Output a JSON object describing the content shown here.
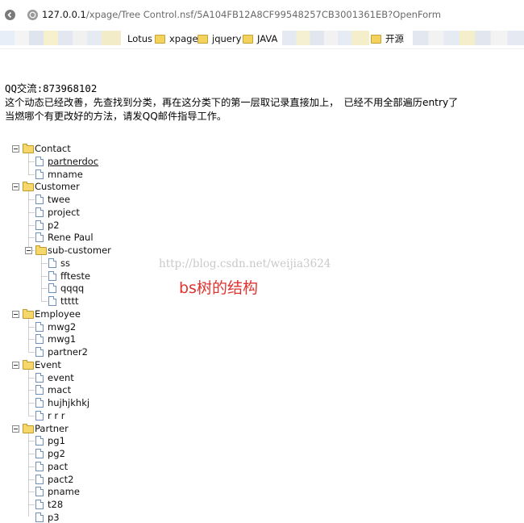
{
  "browser": {
    "url_host": "127.0.0.1",
    "url_path": "/xpage/Tree Control.nsf/5A104FB12A8CF99548257CB3001361EB?OpenForm"
  },
  "bookmarks": [
    {
      "label": "Lotus",
      "icon": "none"
    },
    {
      "label": "xpage",
      "icon": "folder-icon"
    },
    {
      "label": "jquery",
      "icon": "folder-icon"
    },
    {
      "label": "JAVA",
      "icon": "folder-icon"
    },
    {
      "label": "开源",
      "icon": "folder-icon"
    }
  ],
  "page": {
    "qq_line": "QQ交流:873968102",
    "line1": "这个动态已经改善，先查找到分类，再在这分类下的第一层取记录直接加上，　已经不用全部遍历entry了",
    "line2": "当燃哪个有更改好的方法，请发QQ邮件指导工作。"
  },
  "tree": [
    {
      "label": "Contact",
      "children": [
        {
          "label": "partnerdoc",
          "link": true
        },
        {
          "label": "mname"
        }
      ]
    },
    {
      "label": "Customer",
      "children": [
        {
          "label": "twee"
        },
        {
          "label": "project"
        },
        {
          "label": "p2"
        },
        {
          "label": "Rene Paul"
        },
        {
          "label": "sub-customer",
          "children": [
            {
              "label": "ss"
            },
            {
              "label": "ffteste"
            },
            {
              "label": "qqqq"
            },
            {
              "label": "ttttt"
            }
          ]
        }
      ]
    },
    {
      "label": "Employee",
      "children": [
        {
          "label": "mwg2"
        },
        {
          "label": "mwg1"
        },
        {
          "label": "partner2"
        }
      ]
    },
    {
      "label": "Event",
      "children": [
        {
          "label": "event"
        },
        {
          "label": "mact"
        },
        {
          "label": "hujhjkhkj"
        },
        {
          "label": "r r r"
        }
      ]
    },
    {
      "label": "Partner",
      "children": [
        {
          "label": "pg1"
        },
        {
          "label": "pg2"
        },
        {
          "label": "pact"
        },
        {
          "label": "pact2"
        },
        {
          "label": "pname"
        },
        {
          "label": "t28"
        },
        {
          "label": "p3"
        }
      ]
    }
  ],
  "watermark": "http://blog.csdn.net/weijia3624",
  "annotation": "bs树的结构",
  "colors": {
    "annotation": "#e0332f",
    "watermark": "#c9c9c9",
    "folder": "#f6d76b"
  }
}
